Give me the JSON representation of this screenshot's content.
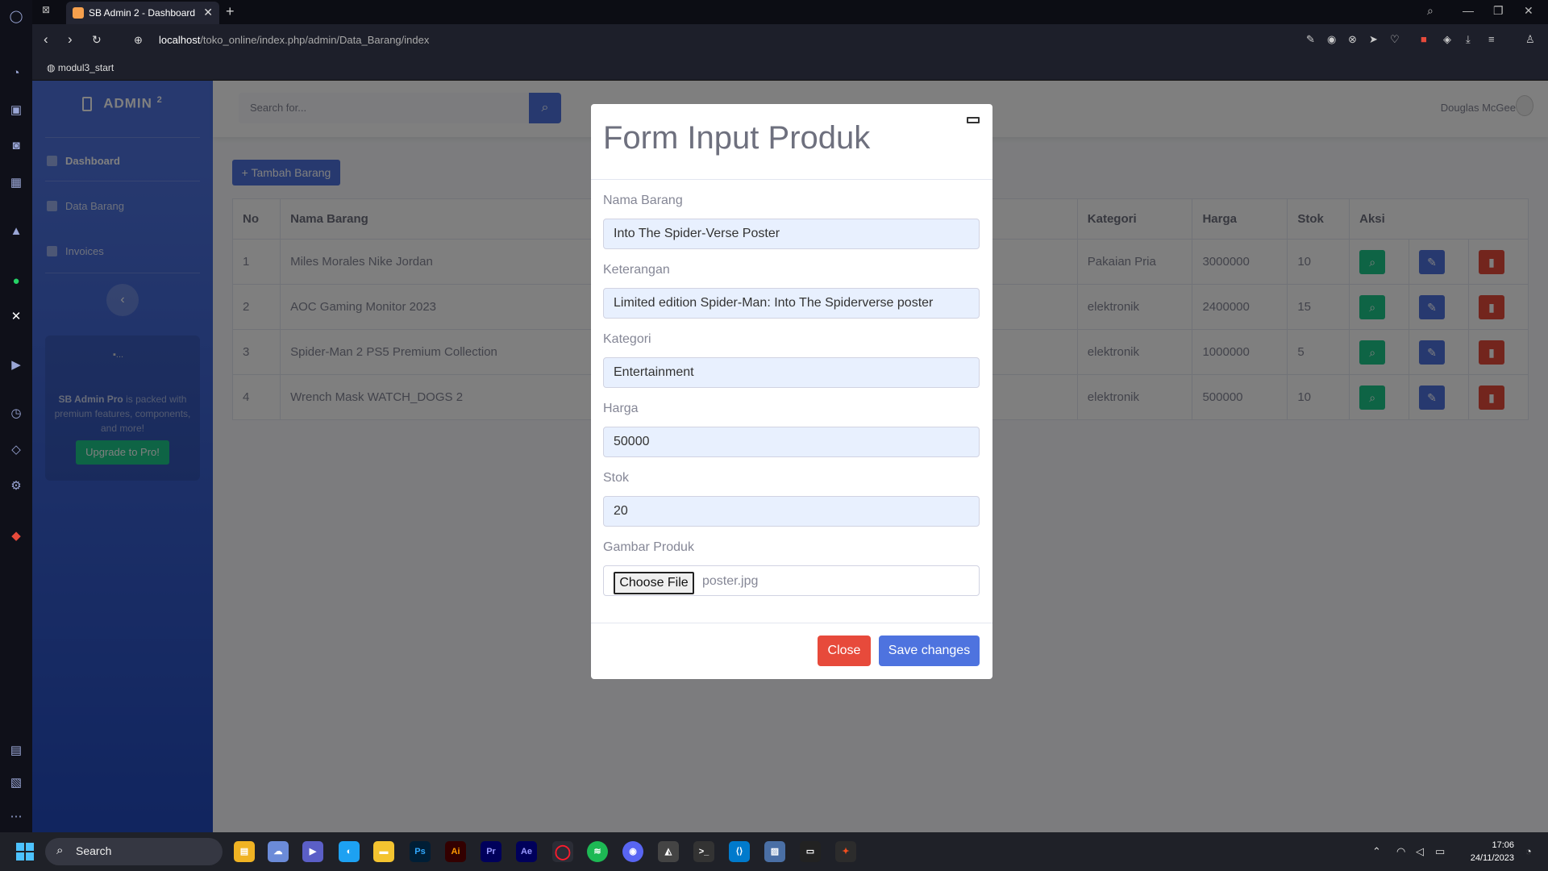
{
  "browser": {
    "tab_title": "SB Admin 2 - Dashboard",
    "url_host": "localhost",
    "url_path": "/toko_online/index.php/admin/Data_Barang/index",
    "bookmark": "modul3_start"
  },
  "sidebar": {
    "brand": "ADMIN",
    "brand_sup": "2",
    "items": [
      {
        "label": "Dashboard"
      },
      {
        "label": "Data Barang"
      },
      {
        "label": "Invoices"
      }
    ],
    "promo_img_alt": "...",
    "promo_brand": "SB Admin Pro",
    "promo_text": " is packed with premium features, components, and more!",
    "upgrade_label": "Upgrade to Pro!"
  },
  "topbar": {
    "search_placeholder": "Search for...",
    "user_name": "Douglas McGee"
  },
  "main": {
    "add_button": "Tambah Barang",
    "headers": [
      "No",
      "Nama Barang",
      "Kategori",
      "Harga",
      "Stok",
      "Aksi"
    ],
    "rows": [
      {
        "no": "1",
        "nama": "Miles Morales Nike Jordan",
        "kategori": "Pakaian Pria",
        "harga": "3000000",
        "stok": "10"
      },
      {
        "no": "2",
        "nama": "AOC Gaming Monitor 2023",
        "kategori": "elektronik",
        "harga": "2400000",
        "stok": "15"
      },
      {
        "no": "3",
        "nama": "Spider-Man 2 PS5 Premium Collection",
        "kategori": "elektronik",
        "harga": "1000000",
        "stok": "5"
      },
      {
        "no": "4",
        "nama": "Wrench Mask WATCH_DOGS 2",
        "kategori": "elektronik",
        "harga": "500000",
        "stok": "10"
      }
    ]
  },
  "modal": {
    "title": "Form Input Produk",
    "fields": [
      {
        "label": "Nama Barang",
        "value": "Into The Spider-Verse Poster"
      },
      {
        "label": "Keterangan",
        "value": "Limited edition Spider-Man: Into The Spiderverse poster"
      },
      {
        "label": "Kategori",
        "value": "Entertainment"
      },
      {
        "label": "Harga",
        "value": "50000"
      },
      {
        "label": "Stok",
        "value": "20"
      }
    ],
    "file_label": "Gambar Produk",
    "file_button": "Choose File",
    "file_name": "poster.jpg",
    "close_label": "Close",
    "save_label": "Save changes"
  },
  "taskbar": {
    "search_label": "Search",
    "apps": [
      "Ps",
      "Ai",
      "Pr",
      "Ae"
    ],
    "time": "17:06",
    "date": "24/11/2023"
  },
  "colors": {
    "primary": "#4e73df",
    "success": "#1cc88a",
    "danger": "#e74a3b"
  }
}
